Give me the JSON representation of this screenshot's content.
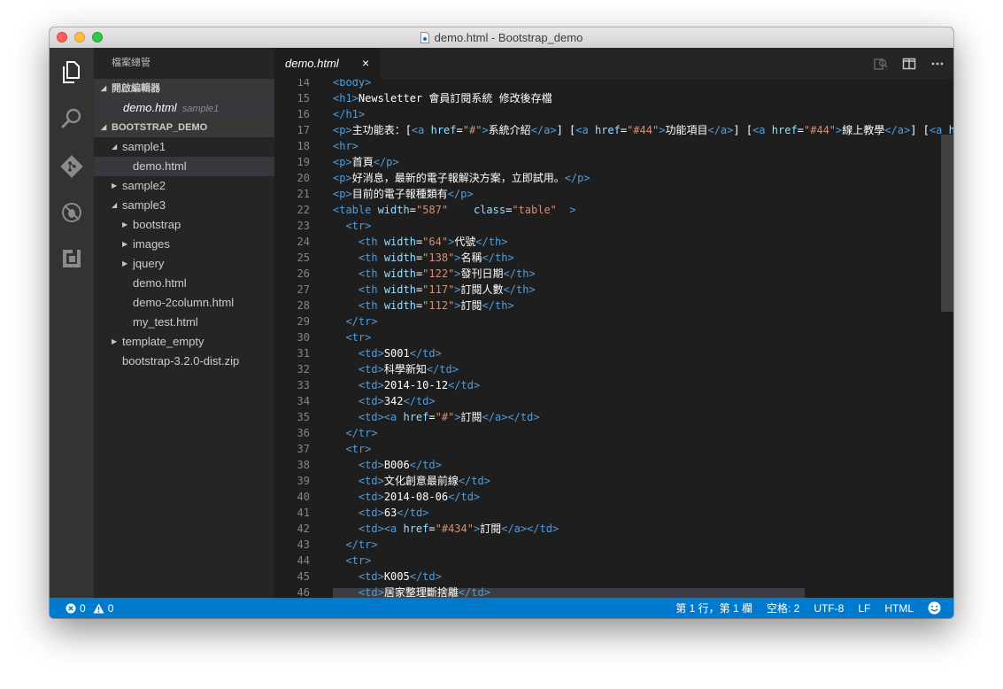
{
  "window": {
    "title": "demo.html - Bootstrap_demo"
  },
  "sidebar": {
    "title": "檔案總管",
    "open_editors_label": "開啟編輯器",
    "open_editor": {
      "name": "demo.html",
      "folder": "sample1"
    },
    "project_label": "BOOTSTRAP_DEMO",
    "tree": [
      {
        "label": "sample1",
        "depth": 1,
        "kind": "folder-open"
      },
      {
        "label": "demo.html",
        "depth": 2,
        "kind": "file",
        "selected": true
      },
      {
        "label": "sample2",
        "depth": 1,
        "kind": "folder-closed"
      },
      {
        "label": "sample3",
        "depth": 1,
        "kind": "folder-open"
      },
      {
        "label": "bootstrap",
        "depth": 2,
        "kind": "folder-closed"
      },
      {
        "label": "images",
        "depth": 2,
        "kind": "folder-closed"
      },
      {
        "label": "jquery",
        "depth": 2,
        "kind": "folder-closed"
      },
      {
        "label": "demo.html",
        "depth": 2,
        "kind": "file"
      },
      {
        "label": "demo-2column.html",
        "depth": 2,
        "kind": "file"
      },
      {
        "label": "my_test.html",
        "depth": 2,
        "kind": "file"
      },
      {
        "label": "template_empty",
        "depth": 1,
        "kind": "folder-closed"
      },
      {
        "label": "bootstrap-3.2.0-dist.zip",
        "depth": 1,
        "kind": "file"
      }
    ]
  },
  "activity_icons": [
    "files-icon",
    "search-icon",
    "git-icon",
    "debug-icon",
    "extensions-icon"
  ],
  "editor": {
    "tab_label": "demo.html",
    "tab_close": "×",
    "actions": [
      "open-changes-icon",
      "split-editor-icon",
      "more-icon"
    ],
    "lines": [
      {
        "n": "14",
        "segs": [
          [
            "tg",
            "<body>"
          ]
        ]
      },
      {
        "n": "15",
        "segs": [
          [
            "tg",
            "<h1>"
          ],
          [
            "tx",
            "Newsletter 會員訂閱系統 修改後存檔"
          ]
        ]
      },
      {
        "n": "16",
        "segs": [
          [
            "tg",
            "</h1>"
          ]
        ]
      },
      {
        "n": "17",
        "segs": [
          [
            "tg",
            "<p>"
          ],
          [
            "tx",
            "主功能表：["
          ],
          [
            "tg",
            "<a "
          ],
          [
            "at",
            "href"
          ],
          [
            "tx",
            "="
          ],
          [
            "sv",
            "\"#\""
          ],
          [
            "tg",
            ">"
          ],
          [
            "tx",
            "系統介紹"
          ],
          [
            "tg",
            "</a>"
          ],
          [
            "tx",
            "] ["
          ],
          [
            "tg",
            "<a "
          ],
          [
            "at",
            "href"
          ],
          [
            "tx",
            "="
          ],
          [
            "sv",
            "\"#44\""
          ],
          [
            "tg",
            ">"
          ],
          [
            "tx",
            "功能項目"
          ],
          [
            "tg",
            "</a>"
          ],
          [
            "tx",
            "] ["
          ],
          [
            "tg",
            "<a "
          ],
          [
            "at",
            "href"
          ],
          [
            "tx",
            "="
          ],
          [
            "sv",
            "\"#44\""
          ],
          [
            "tg",
            ">"
          ],
          [
            "tx",
            "線上教學"
          ],
          [
            "tg",
            "</a>"
          ],
          [
            "tx",
            "] ["
          ],
          [
            "tg",
            "<a "
          ],
          [
            "at",
            "h"
          ]
        ]
      },
      {
        "n": "18",
        "segs": [
          [
            "tg",
            "<hr>"
          ]
        ]
      },
      {
        "n": "19",
        "segs": [
          [
            "tg",
            "<p>"
          ],
          [
            "tx",
            "首頁"
          ],
          [
            "tg",
            "</p>"
          ]
        ]
      },
      {
        "n": "20",
        "segs": [
          [
            "tg",
            "<p>"
          ],
          [
            "tx",
            "好消息，最新的電子報解決方案，立即試用。"
          ],
          [
            "tg",
            "</p>"
          ]
        ]
      },
      {
        "n": "21",
        "segs": [
          [
            "tg",
            "<p>"
          ],
          [
            "tx",
            "目前的電子報種類有"
          ],
          [
            "tg",
            "</p>"
          ]
        ]
      },
      {
        "n": "22",
        "segs": [
          [
            "tg",
            "<table "
          ],
          [
            "at",
            "width"
          ],
          [
            "tx",
            "="
          ],
          [
            "sv",
            "\"587\""
          ],
          [
            "tx",
            "    "
          ],
          [
            "at",
            "class"
          ],
          [
            "tx",
            "="
          ],
          [
            "sv",
            "\"table\""
          ],
          [
            "tx",
            "  "
          ],
          [
            "tg",
            ">"
          ]
        ]
      },
      {
        "n": "23",
        "segs": [
          [
            "tx",
            "  "
          ],
          [
            "tg",
            "<tr>"
          ]
        ]
      },
      {
        "n": "24",
        "segs": [
          [
            "tx",
            "    "
          ],
          [
            "tg",
            "<th "
          ],
          [
            "at",
            "width"
          ],
          [
            "tx",
            "="
          ],
          [
            "sv",
            "\"64\""
          ],
          [
            "tg",
            ">"
          ],
          [
            "tx",
            "代號"
          ],
          [
            "tg",
            "</th>"
          ]
        ]
      },
      {
        "n": "25",
        "segs": [
          [
            "tx",
            "    "
          ],
          [
            "tg",
            "<th "
          ],
          [
            "at",
            "width"
          ],
          [
            "tx",
            "="
          ],
          [
            "sv",
            "\"138\""
          ],
          [
            "tg",
            ">"
          ],
          [
            "tx",
            "名稱"
          ],
          [
            "tg",
            "</th>"
          ]
        ]
      },
      {
        "n": "26",
        "segs": [
          [
            "tx",
            "    "
          ],
          [
            "tg",
            "<th "
          ],
          [
            "at",
            "width"
          ],
          [
            "tx",
            "="
          ],
          [
            "sv",
            "\"122\""
          ],
          [
            "tg",
            ">"
          ],
          [
            "tx",
            "發刊日期"
          ],
          [
            "tg",
            "</th>"
          ]
        ]
      },
      {
        "n": "27",
        "segs": [
          [
            "tx",
            "    "
          ],
          [
            "tg",
            "<th "
          ],
          [
            "at",
            "width"
          ],
          [
            "tx",
            "="
          ],
          [
            "sv",
            "\"117\""
          ],
          [
            "tg",
            ">"
          ],
          [
            "tx",
            "訂閱人數"
          ],
          [
            "tg",
            "</th>"
          ]
        ]
      },
      {
        "n": "28",
        "segs": [
          [
            "tx",
            "    "
          ],
          [
            "tg",
            "<th "
          ],
          [
            "at",
            "width"
          ],
          [
            "tx",
            "="
          ],
          [
            "sv",
            "\"112\""
          ],
          [
            "tg",
            ">"
          ],
          [
            "tx",
            "訂閱"
          ],
          [
            "tg",
            "</th>"
          ]
        ]
      },
      {
        "n": "29",
        "segs": [
          [
            "tx",
            "  "
          ],
          [
            "tg",
            "</tr>"
          ]
        ]
      },
      {
        "n": "30",
        "segs": [
          [
            "tx",
            "  "
          ],
          [
            "tg",
            "<tr>"
          ]
        ]
      },
      {
        "n": "31",
        "segs": [
          [
            "tx",
            "    "
          ],
          [
            "tg",
            "<td>"
          ],
          [
            "tx",
            "S001"
          ],
          [
            "tg",
            "</td>"
          ]
        ]
      },
      {
        "n": "32",
        "segs": [
          [
            "tx",
            "    "
          ],
          [
            "tg",
            "<td>"
          ],
          [
            "tx",
            "科學新知"
          ],
          [
            "tg",
            "</td>"
          ]
        ]
      },
      {
        "n": "33",
        "segs": [
          [
            "tx",
            "    "
          ],
          [
            "tg",
            "<td>"
          ],
          [
            "tx",
            "2014-10-12"
          ],
          [
            "tg",
            "</td>"
          ]
        ]
      },
      {
        "n": "34",
        "segs": [
          [
            "tx",
            "    "
          ],
          [
            "tg",
            "<td>"
          ],
          [
            "tx",
            "342"
          ],
          [
            "tg",
            "</td>"
          ]
        ]
      },
      {
        "n": "35",
        "segs": [
          [
            "tx",
            "    "
          ],
          [
            "tg",
            "<td><a "
          ],
          [
            "at",
            "href"
          ],
          [
            "tx",
            "="
          ],
          [
            "sv",
            "\"#\""
          ],
          [
            "tg",
            ">"
          ],
          [
            "tx",
            "訂閱"
          ],
          [
            "tg",
            "</a></td>"
          ]
        ]
      },
      {
        "n": "36",
        "segs": [
          [
            "tx",
            "  "
          ],
          [
            "tg",
            "</tr>"
          ]
        ]
      },
      {
        "n": "37",
        "segs": [
          [
            "tx",
            "  "
          ],
          [
            "tg",
            "<tr>"
          ]
        ]
      },
      {
        "n": "38",
        "segs": [
          [
            "tx",
            "    "
          ],
          [
            "tg",
            "<td>"
          ],
          [
            "tx",
            "B006"
          ],
          [
            "tg",
            "</td>"
          ]
        ]
      },
      {
        "n": "39",
        "segs": [
          [
            "tx",
            "    "
          ],
          [
            "tg",
            "<td>"
          ],
          [
            "tx",
            "文化創意最前線"
          ],
          [
            "tg",
            "</td>"
          ]
        ]
      },
      {
        "n": "40",
        "segs": [
          [
            "tx",
            "    "
          ],
          [
            "tg",
            "<td>"
          ],
          [
            "tx",
            "2014-08-06"
          ],
          [
            "tg",
            "</td>"
          ]
        ]
      },
      {
        "n": "41",
        "segs": [
          [
            "tx",
            "    "
          ],
          [
            "tg",
            "<td>"
          ],
          [
            "tx",
            "63"
          ],
          [
            "tg",
            "</td>"
          ]
        ]
      },
      {
        "n": "42",
        "segs": [
          [
            "tx",
            "    "
          ],
          [
            "tg",
            "<td><a "
          ],
          [
            "at",
            "href"
          ],
          [
            "tx",
            "="
          ],
          [
            "sv",
            "\"#434\""
          ],
          [
            "tg",
            ">"
          ],
          [
            "tx",
            "訂閱"
          ],
          [
            "tg",
            "</a></td>"
          ]
        ]
      },
      {
        "n": "43",
        "segs": [
          [
            "tx",
            "  "
          ],
          [
            "tg",
            "</tr>"
          ]
        ]
      },
      {
        "n": "44",
        "segs": [
          [
            "tx",
            "  "
          ],
          [
            "tg",
            "<tr>"
          ]
        ]
      },
      {
        "n": "45",
        "segs": [
          [
            "tx",
            "    "
          ],
          [
            "tg",
            "<td>"
          ],
          [
            "tx",
            "K005"
          ],
          [
            "tg",
            "</td>"
          ]
        ]
      },
      {
        "n": "46",
        "segs": [
          [
            "tx",
            "    "
          ],
          [
            "tg",
            "<td>"
          ],
          [
            "tx",
            "居家整理斷捨離"
          ],
          [
            "tg",
            "</td>"
          ]
        ]
      }
    ]
  },
  "status": {
    "errors": "0",
    "warnings": "0",
    "position": "第 1 行，第 1 欄",
    "spaces": "空格: 2",
    "encoding": "UTF-8",
    "eol": "LF",
    "language": "HTML"
  },
  "colors": {
    "accent": "#007acc",
    "tag": "#569cd6",
    "attr": "#9cdcfe",
    "string": "#ce9178"
  }
}
